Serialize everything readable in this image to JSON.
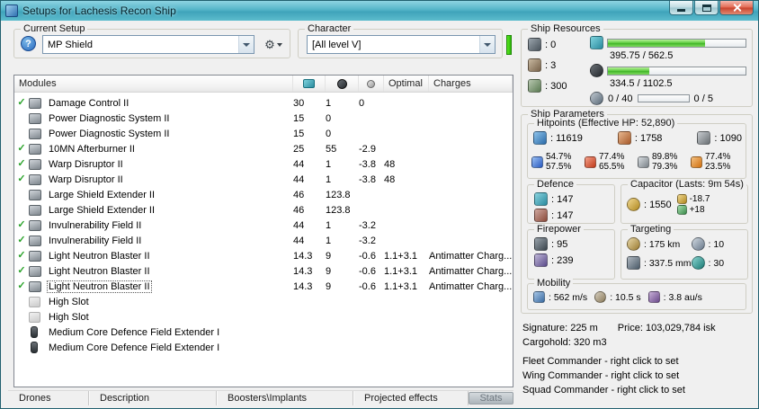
{
  "window": {
    "title": "Setups for Lachesis Recon Ship"
  },
  "setup": {
    "group_label": "Current Setup",
    "value": "MP Shield",
    "help_glyph": "?",
    "tools_glyph": "⚙"
  },
  "character": {
    "group_label": "Character",
    "value": "[All level V]"
  },
  "modules": {
    "check_glyph": "✓",
    "header": {
      "name": "Modules",
      "optimal": "Optimal",
      "charges": "Charges"
    },
    "rows": [
      {
        "active": true,
        "icon": "module",
        "name": "Damage Control II",
        "cpu": "30",
        "pg": "1",
        "cap": "0",
        "optimal": "",
        "charges": ""
      },
      {
        "active": false,
        "icon": "module",
        "name": "Power Diagnostic System II",
        "cpu": "15",
        "pg": "0",
        "cap": "",
        "optimal": "",
        "charges": ""
      },
      {
        "active": false,
        "icon": "module",
        "name": "Power Diagnostic System II",
        "cpu": "15",
        "pg": "0",
        "cap": "",
        "optimal": "",
        "charges": ""
      },
      {
        "active": true,
        "icon": "module",
        "name": "10MN Afterburner II",
        "cpu": "25",
        "pg": "55",
        "cap": "-2.9",
        "optimal": "",
        "charges": ""
      },
      {
        "active": true,
        "icon": "module",
        "name": "Warp Disruptor II",
        "cpu": "44",
        "pg": "1",
        "cap": "-3.8",
        "optimal": "48",
        "charges": ""
      },
      {
        "active": true,
        "icon": "module",
        "name": "Warp Disruptor II",
        "cpu": "44",
        "pg": "1",
        "cap": "-3.8",
        "optimal": "48",
        "charges": ""
      },
      {
        "active": false,
        "icon": "module",
        "name": "Large Shield Extender II",
        "cpu": "46",
        "pg": "123.8",
        "cap": "",
        "optimal": "",
        "charges": ""
      },
      {
        "active": false,
        "icon": "module",
        "name": "Large Shield Extender II",
        "cpu": "46",
        "pg": "123.8",
        "cap": "",
        "optimal": "",
        "charges": ""
      },
      {
        "active": true,
        "icon": "module",
        "name": "Invulnerability Field II",
        "cpu": "44",
        "pg": "1",
        "cap": "-3.2",
        "optimal": "",
        "charges": ""
      },
      {
        "active": true,
        "icon": "module",
        "name": "Invulnerability Field II",
        "cpu": "44",
        "pg": "1",
        "cap": "-3.2",
        "optimal": "",
        "charges": ""
      },
      {
        "active": true,
        "icon": "module",
        "name": "Light Neutron Blaster II",
        "cpu": "14.3",
        "pg": "9",
        "cap": "-0.6",
        "optimal": "1.1+3.1",
        "charges": "Antimatter Charg..."
      },
      {
        "active": true,
        "icon": "module",
        "name": "Light Neutron Blaster II",
        "cpu": "14.3",
        "pg": "9",
        "cap": "-0.6",
        "optimal": "1.1+3.1",
        "charges": "Antimatter Charg..."
      },
      {
        "active": true,
        "icon": "module",
        "name": "Light Neutron Blaster II",
        "selected": true,
        "cpu": "14.3",
        "pg": "9",
        "cap": "-0.6",
        "optimal": "1.1+3.1",
        "charges": "Antimatter Charg..."
      },
      {
        "active": false,
        "icon": "slot",
        "name": "High Slot",
        "cpu": "",
        "pg": "",
        "cap": "",
        "optimal": "",
        "charges": ""
      },
      {
        "active": false,
        "icon": "slot",
        "name": "High Slot",
        "cpu": "",
        "pg": "",
        "cap": "",
        "optimal": "",
        "charges": ""
      },
      {
        "active": false,
        "icon": "rig",
        "name": "Medium Core Defence Field Extender I",
        "cpu": "",
        "pg": "",
        "cap": "",
        "optimal": "",
        "charges": ""
      },
      {
        "active": false,
        "icon": "rig",
        "name": "Medium Core Defence Field Extender I",
        "cpu": "",
        "pg": "",
        "cap": "",
        "optimal": "",
        "charges": ""
      }
    ]
  },
  "tabs": [
    "Drones",
    "Description",
    "Boosters\\Implants",
    "Projected effects"
  ],
  "stats_button": "Stats",
  "resources": {
    "group_label": "Ship Resources",
    "turrets": ": 0",
    "launchers": ": 3",
    "calibration": ": 300",
    "cpu": "395.75 / 562.5",
    "powergrid": "334.5 / 1102.5",
    "dronebay": "0 / 40",
    "dronebandwidth": "0 / 5"
  },
  "parameters": {
    "group_label": "Ship Parameters",
    "hitpoints": {
      "group_label": "Hitpoints (Effective HP: 52,890)",
      "shield": ": 11619",
      "armor": ": 1758",
      "hull": ": 1090",
      "resists": [
        {
          "type": "em",
          "shield": "54.7%",
          "armor": "57.5%"
        },
        {
          "type": "thermal",
          "shield": "77.4%",
          "armor": "65.5%"
        },
        {
          "type": "kinetic",
          "shield": "89.8%",
          "armor": "79.3%"
        },
        {
          "type": "explosive",
          "shield": "77.4%",
          "armor": "23.5%"
        }
      ]
    },
    "defence": {
      "group_label": "Defence",
      "shield_recharge": ": 147",
      "armor_repair": ": 147"
    },
    "capacitor": {
      "group_label": "Capacitor (Lasts: 9m 54s)",
      "capacity": ": 1550",
      "drain": "-18.7",
      "boost": "+18"
    },
    "firepower": {
      "group_label": "Firepower",
      "dps": ": 95",
      "volley": ": 239"
    },
    "targeting": {
      "group_label": "Targeting",
      "range": ": 175 km",
      "max_targets": ": 10",
      "scan_resolution": ": 337.5 mm",
      "sensor_strength": ": 30"
    },
    "mobility": {
      "group_label": "Mobility",
      "speed": ": 562 m/s",
      "align_time": ": 10.5 s",
      "warp_speed": ": 3.8 au/s"
    }
  },
  "summary": {
    "signature": "Signature: 225 m",
    "price": "Price: 103,029,784 isk",
    "cargohold": "Cargohold: 320 m3",
    "fleet_commander": "Fleet Commander - right click to set",
    "wing_commander": "Wing Commander - right click to set",
    "squad_commander": "Squad Commander - right click to set"
  }
}
